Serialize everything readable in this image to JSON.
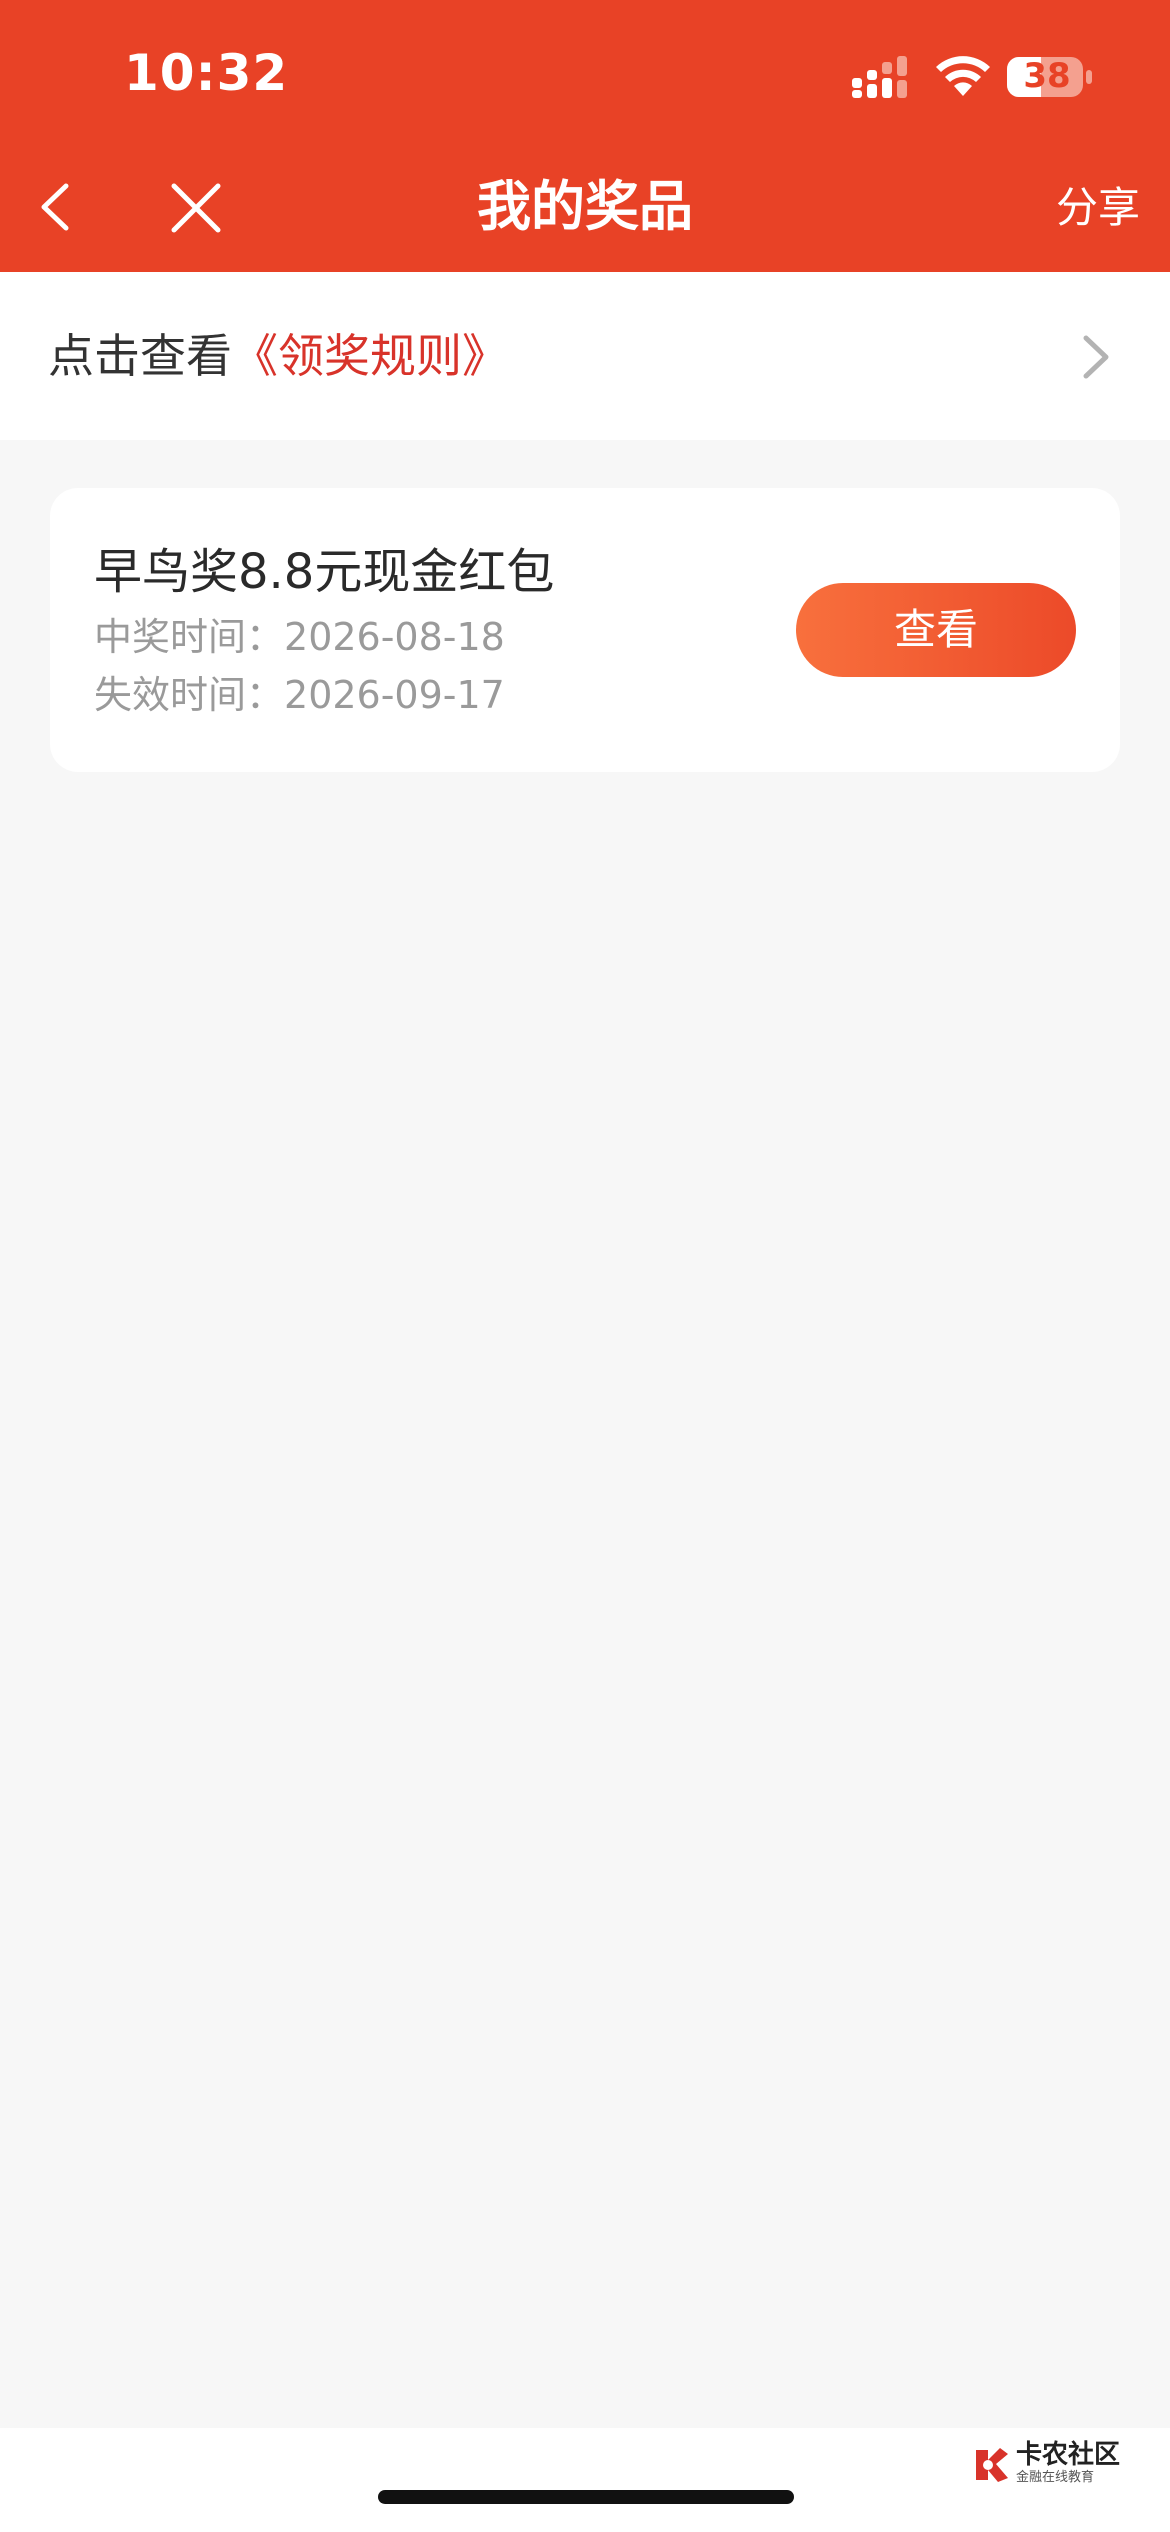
{
  "status_bar": {
    "time": "10:32",
    "battery_level": "38",
    "icons": [
      "signal-icon",
      "wifi-icon",
      "battery-icon"
    ]
  },
  "nav": {
    "title": "我的奖品",
    "share_label": "分享",
    "icons": [
      "back-chevron-icon",
      "close-icon"
    ]
  },
  "rules": {
    "prefix": "点击查看",
    "link": "《领奖规则》",
    "icon": "chevron-right-icon"
  },
  "prize": {
    "name": "早鸟奖8.8元现金红包",
    "win_label": "中奖时间：",
    "win_date": "2026-08-18",
    "expire_label": "失效时间：",
    "expire_date": "2026-09-17",
    "button_label": "查看"
  },
  "watermark": {
    "title": "卡农社区",
    "subtitle": "金融在线教育"
  },
  "colors": {
    "header_bg": "#e84226",
    "link_red": "#d8332a",
    "button_start": "#f8703d",
    "button_end": "#ec4a29",
    "page_bg": "#f7f7f7"
  }
}
